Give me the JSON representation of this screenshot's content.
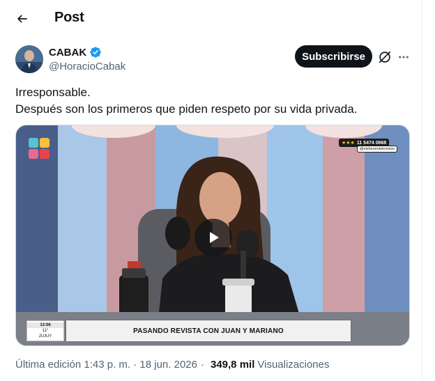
{
  "header": {
    "title": "Post",
    "back_icon": "arrow-left-icon"
  },
  "author": {
    "name": "CABAK",
    "handle": "@HoracioCabak",
    "verified_color": "#1d9bf0"
  },
  "actions": {
    "subscribe_label": "Subscribirse",
    "grok_icon": "grok-icon",
    "more_icon": "more-horizontal-icon"
  },
  "tweet": {
    "lines": [
      "Irresponsable.",
      "Después son los primeros que piden respeto por su vida privada."
    ]
  },
  "media": {
    "lower_third": "PASANDO REVISTA CON JUAN Y MARIANO",
    "phone": "11 5474 0668",
    "handle_badge": "@elsheventelevisivo",
    "clock_time": "13:06",
    "clock_temp": "11°",
    "clock_place": "JUJUY",
    "play_icon": "play-icon"
  },
  "meta": {
    "edited": "Última edición 1:43 p. m. · 18 jun. 2026",
    "separator": "·",
    "views_count": "349,8 mil",
    "views_label": "Visualizaciones"
  },
  "colors": {
    "text_primary": "#0f1419",
    "text_secondary": "#536471",
    "button_bg": "#0f1419",
    "accent": "#1d9bf0"
  }
}
